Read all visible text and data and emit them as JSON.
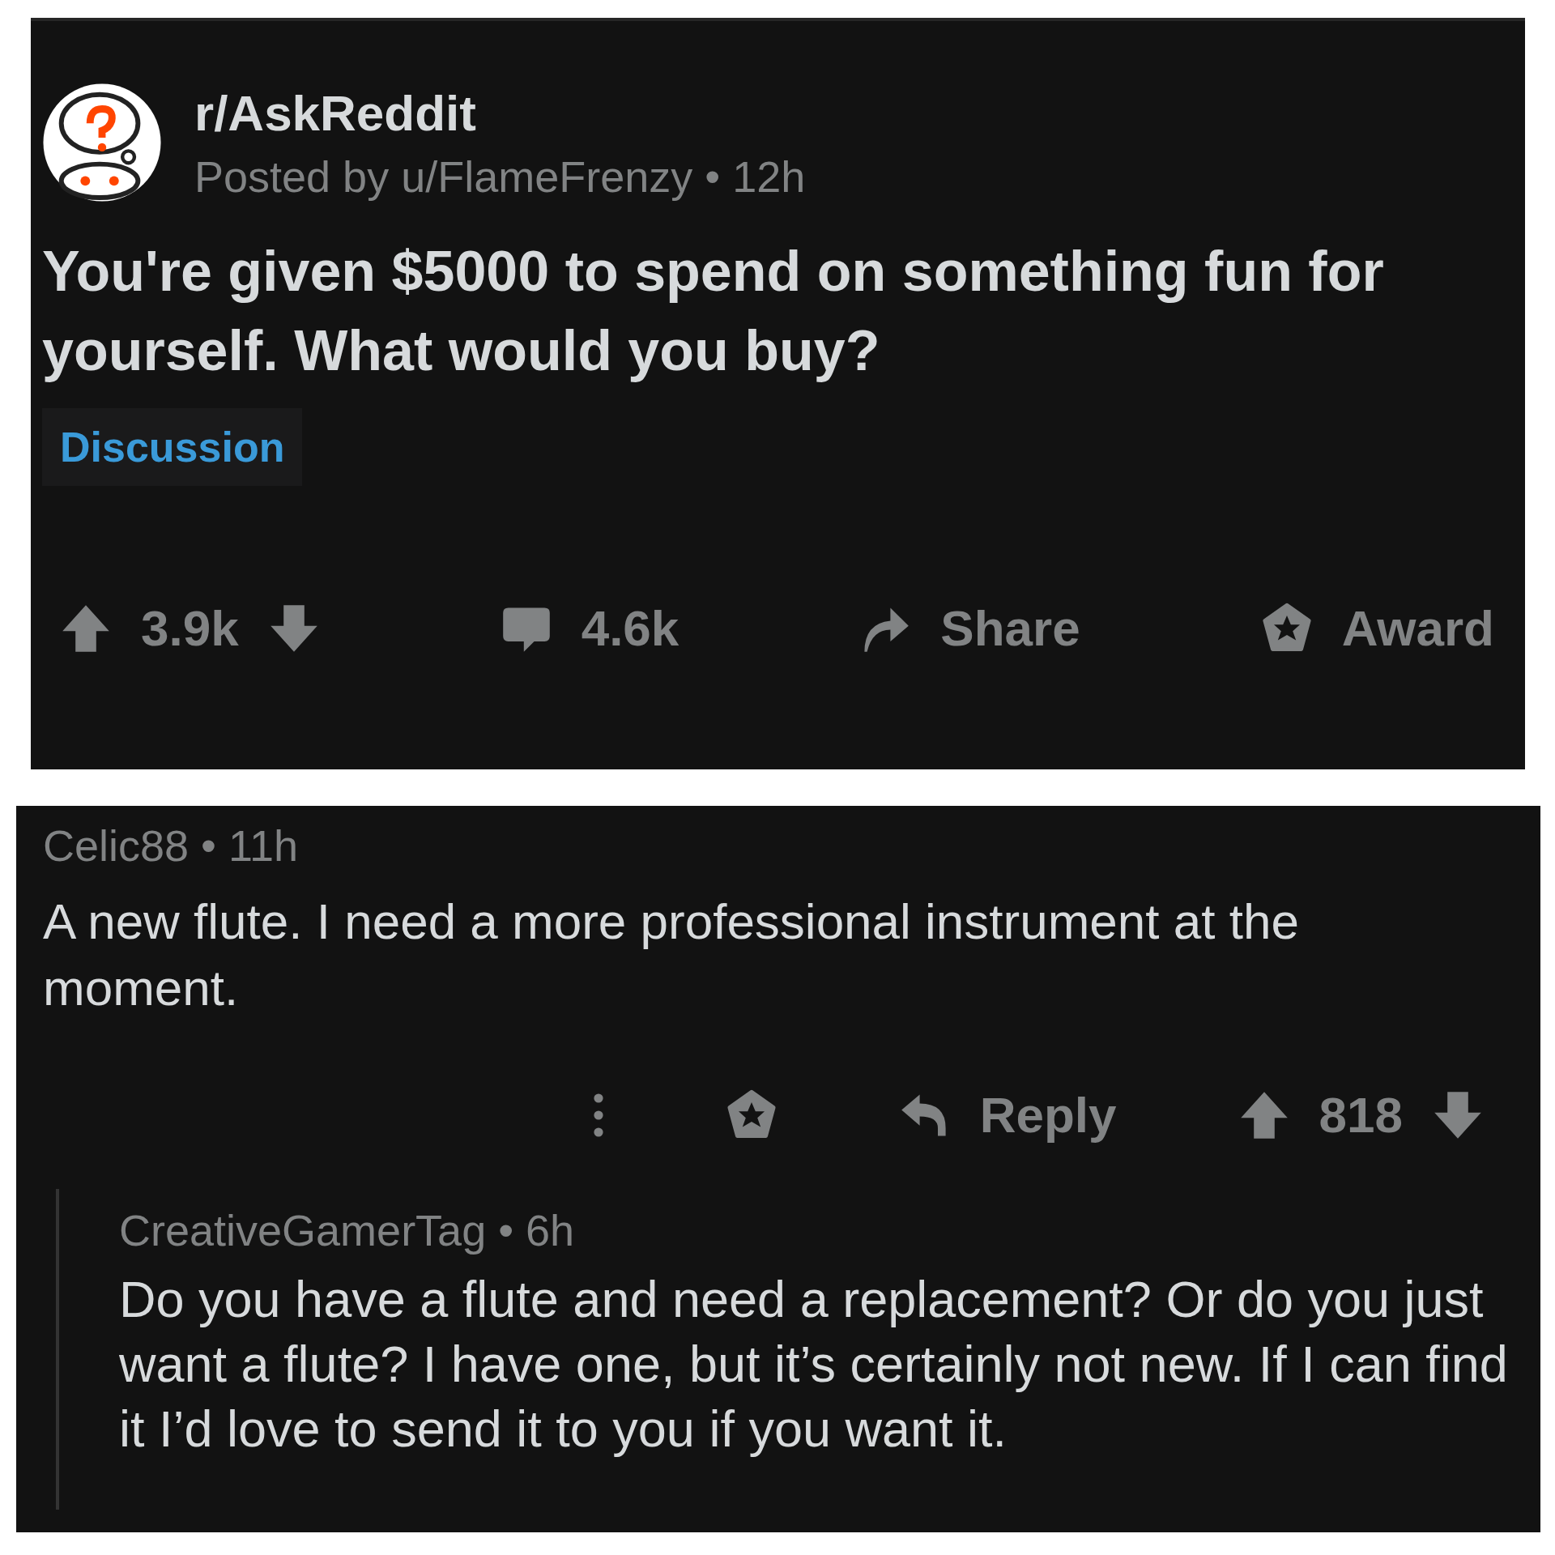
{
  "post": {
    "subreddit": "r/AskReddit",
    "meta": "Posted by u/FlameFrenzy • 12h",
    "title": "You're given $5000 to spend on something fun for yourself. What would you buy?",
    "flair": "Discussion",
    "actions": [
      {
        "kind": "vote",
        "label": "3.9k"
      },
      {
        "kind": "comments",
        "label": "4.6k"
      },
      {
        "kind": "share",
        "label": "Share"
      },
      {
        "kind": "award",
        "label": "Award"
      }
    ]
  },
  "comment": {
    "meta": "Celic88 • 11h",
    "body": "A new flute. I need a more professional instrument at the moment.",
    "reply": "Reply",
    "score": "818"
  },
  "reply": {
    "meta": "CreativeGamerTag • 6h",
    "body": "Do you have a flute and need a replacement? Or do you just want a flute? I have one, but it’s certainly not new. If I can find it I’d love to send it to you if you want it."
  }
}
